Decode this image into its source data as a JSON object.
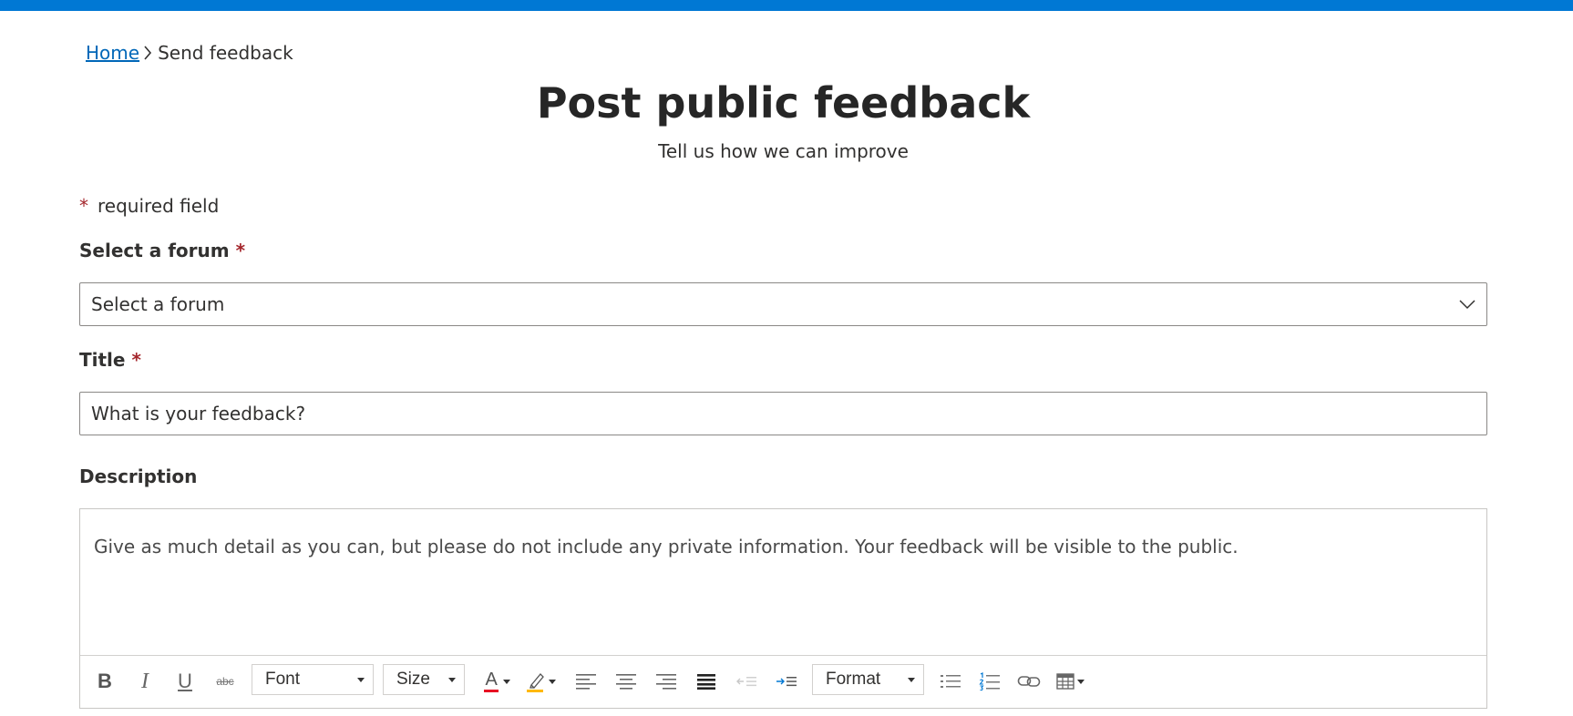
{
  "breadcrumb": {
    "home": "Home",
    "current": "Send feedback"
  },
  "header": {
    "title": "Post public feedback",
    "subtitle": "Tell us how we can improve"
  },
  "required_note": {
    "star": "*",
    "text": "required field"
  },
  "forum": {
    "label": "Select a forum",
    "required_star": "*",
    "value": "Select a forum"
  },
  "title_field": {
    "label": "Title",
    "required_star": "*",
    "placeholder": "What is your feedback?"
  },
  "description": {
    "label": "Description",
    "placeholder": "Give as much detail as you can, but please do not include any private information. Your feedback will be visible to the public."
  },
  "toolbar": {
    "font_label": "Font",
    "size_label": "Size",
    "format_label": "Format",
    "bold_glyph": "B",
    "italic_glyph": "I",
    "underline_glyph": "U",
    "strike_glyph": "abc",
    "font_color_glyph": "A"
  },
  "colors": {
    "accent": "#0078d4",
    "link": "#0067b8",
    "required": "#a4262c",
    "text": "#323130"
  }
}
